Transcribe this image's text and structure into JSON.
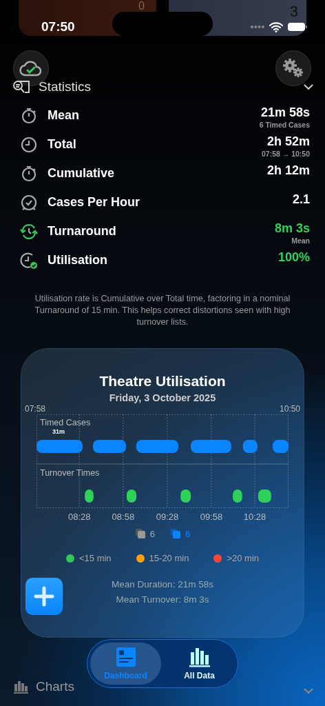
{
  "background_cards": [
    {
      "value": "0"
    },
    {
      "value": "3"
    }
  ],
  "status_bar": {
    "time": "07:50"
  },
  "statistics": {
    "title": "Statistics",
    "expanded": true,
    "rows": [
      {
        "kind": "stopwatch",
        "label": "Mean",
        "value": "21m 58s",
        "sub": "6 Timed Cases",
        "highlight": false
      },
      {
        "kind": "clock",
        "label": "Total",
        "value": "2h 52m",
        "sub": "07:58 → 10:50",
        "highlight": false
      },
      {
        "kind": "stopwatch",
        "label": "Cumulative",
        "value": "2h 12m",
        "highlight": false
      },
      {
        "kind": "alarm",
        "label": "Cases Per Hour",
        "value": "2.1",
        "highlight": false
      },
      {
        "kind": "turnaround",
        "label": "Turnaround",
        "value": "8m 3s",
        "sub": "Mean",
        "highlight": true
      },
      {
        "kind": "clock-check",
        "label": "Utilisation",
        "value": "100%",
        "highlight": true
      }
    ],
    "note": "Utilisation rate is Cumulative over Total time, factoring in a nominal Turnaround of 15 min. This helps correct distortions seen with high turnover lists."
  },
  "utilisation_card": {
    "title": "Theatre Utilisation",
    "date": "Friday, 3 October 2025",
    "start": "07:58",
    "end": "10:50",
    "lanes": [
      "Timed Cases",
      "Turnover Times"
    ],
    "bar_label": "31m",
    "ticks": [
      "08:28",
      "08:58",
      "09:28",
      "09:58",
      "10:28"
    ],
    "counts": [
      {
        "kind": "all",
        "value": "6"
      },
      {
        "kind": "timed",
        "value": "6"
      }
    ],
    "legend": [
      {
        "label": "<15 min",
        "color": "#34c759"
      },
      {
        "label": "15-20 min",
        "color": "#ff9f0a"
      },
      {
        "label": ">20 min",
        "color": "#ff453a"
      }
    ],
    "summary": [
      "Mean Duration: 21m 58s",
      "Mean Turnover: 8m 3s"
    ]
  },
  "tab_bar": [
    {
      "label": "Dashboard",
      "kind": "dashboard",
      "selected": true
    },
    {
      "label": "All Data",
      "kind": "chart",
      "selected": false
    }
  ],
  "next_section": {
    "title": "Charts",
    "expanded": false
  }
}
